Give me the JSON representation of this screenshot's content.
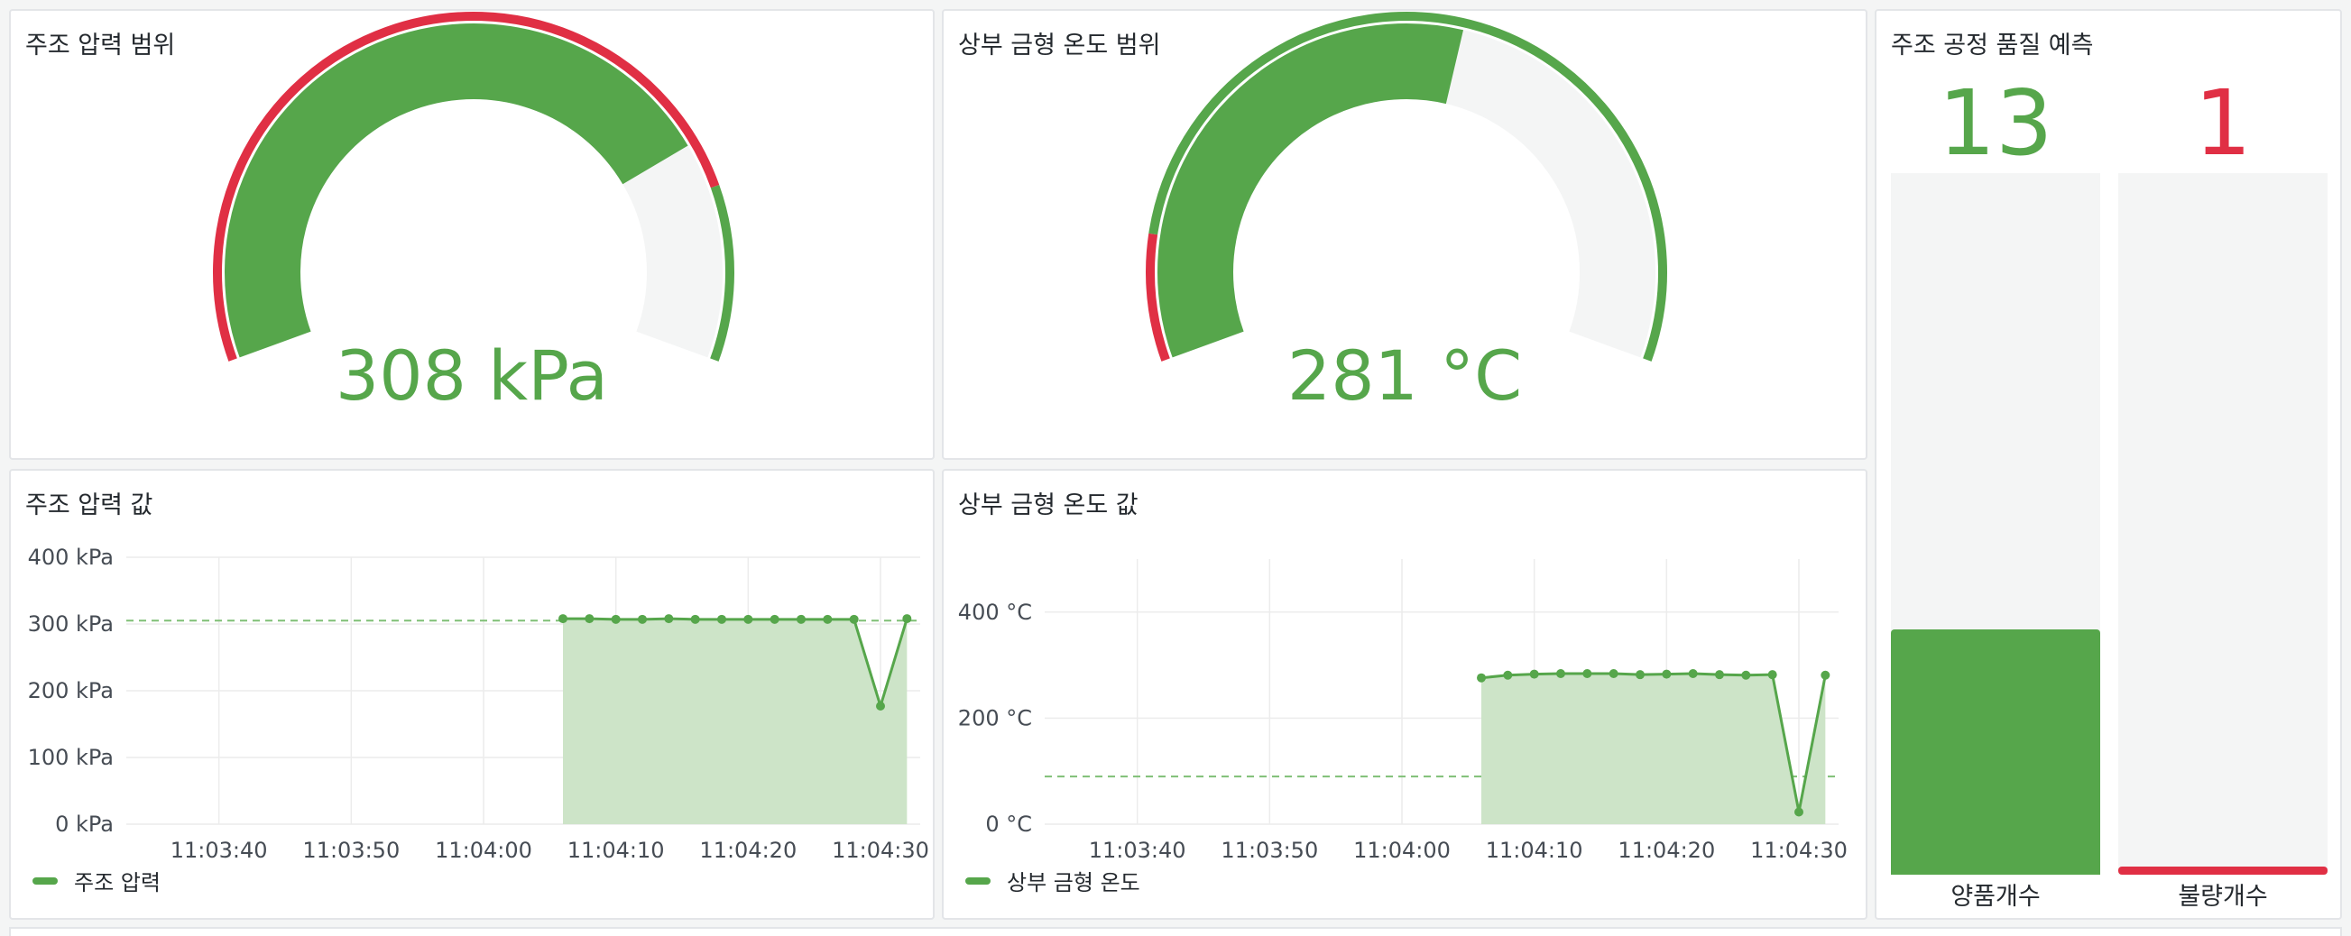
{
  "colors": {
    "green": "#56a64b",
    "red": "#e02f44",
    "track": "#f4f5f5",
    "fill": "#cde4c8"
  },
  "gauge_pressure": {
    "title": "주조 압력 범위",
    "value_text": "308 kPa",
    "value": 308,
    "min": 0,
    "max": 400,
    "value_fraction": 0.77,
    "threshold_bands": [
      {
        "color": "red",
        "from_fraction": 0.0,
        "to_fraction": 0.82
      },
      {
        "color": "green",
        "from_fraction": 0.82,
        "to_fraction": 1.0
      }
    ]
  },
  "gauge_temp": {
    "title": "상부 금형 온도 범위",
    "value_text": "281 °C",
    "value": 281,
    "min": 0,
    "max": 500,
    "value_fraction": 0.56,
    "threshold_bands": [
      {
        "color": "red",
        "from_fraction": 0.0,
        "to_fraction": 0.13
      },
      {
        "color": "green",
        "from_fraction": 0.13,
        "to_fraction": 1.0
      }
    ]
  },
  "chart_pressure": {
    "title": "주조 압력 값",
    "legend": "주조 압력"
  },
  "chart_temp": {
    "title": "상부 금형 온도 값",
    "legend": "상부 금형 온도"
  },
  "quality": {
    "title": "주조 공정 품질 예측",
    "good": {
      "label": "양품개수",
      "value": "13",
      "fill_fraction": 0.35
    },
    "bad": {
      "label": "불량개수",
      "value": "1",
      "fill_fraction": 0.012
    }
  },
  "chart_data": [
    {
      "type": "area",
      "title": "주조 압력 값",
      "xlabel": "",
      "ylabel": "",
      "x_ticks": [
        "11:03:40",
        "11:03:50",
        "11:04:00",
        "11:04:10",
        "11:04:20",
        "11:04:30"
      ],
      "y_ticks": [
        "0 kPa",
        "100 kPa",
        "200 kPa",
        "300 kPa",
        "400 kPa"
      ],
      "xlim": [
        "11:03:33",
        "11:04:33"
      ],
      "ylim": [
        0,
        400
      ],
      "threshold": 305,
      "grid": true,
      "legend_position": "bottom-left",
      "series": [
        {
          "name": "주조 압력",
          "x": [
            "11:04:06",
            "11:04:08",
            "11:04:10",
            "11:04:12",
            "11:04:14",
            "11:04:16",
            "11:04:18",
            "11:04:20",
            "11:04:22",
            "11:04:24",
            "11:04:26",
            "11:04:28",
            "11:04:30",
            "11:04:32"
          ],
          "y": [
            308,
            308,
            307,
            307,
            308,
            307,
            307,
            307,
            307,
            307,
            307,
            307,
            177,
            308
          ]
        }
      ]
    },
    {
      "type": "area",
      "title": "상부 금형 온도 값",
      "xlabel": "",
      "ylabel": "",
      "x_ticks": [
        "11:03:40",
        "11:03:50",
        "11:04:00",
        "11:04:10",
        "11:04:20",
        "11:04:30"
      ],
      "y_ticks": [
        "0 °C",
        "200 °C",
        "400 °C"
      ],
      "xlim": [
        "11:03:33",
        "11:04:33"
      ],
      "ylim": [
        0,
        500
      ],
      "threshold": 90,
      "grid": true,
      "legend_position": "bottom-left",
      "series": [
        {
          "name": "상부 금형 온도",
          "x": [
            "11:04:06",
            "11:04:08",
            "11:04:10",
            "11:04:12",
            "11:04:14",
            "11:04:16",
            "11:04:18",
            "11:04:20",
            "11:04:22",
            "11:04:24",
            "11:04:26",
            "11:04:28",
            "11:04:30",
            "11:04:32"
          ],
          "y": [
            276,
            281,
            283,
            284,
            284,
            284,
            282,
            283,
            284,
            282,
            281,
            282,
            23,
            281
          ]
        }
      ]
    }
  ]
}
